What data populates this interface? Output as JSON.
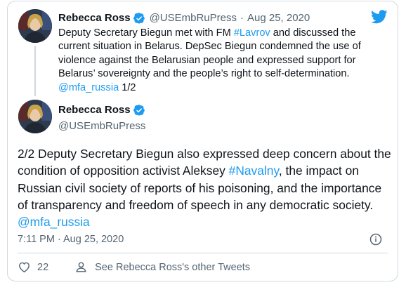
{
  "quoted": {
    "name": "Rebecca Ross",
    "handle": "@USEmbRuPress",
    "separator": "·",
    "date": "Aug 25, 2020",
    "text_1": "Deputy Secretary Biegun met with FM ",
    "hashtag": "#Lavrov",
    "text_2": " and discussed the current situation in Belarus. DepSec Biegun condemned the use of violence against the Belarusian people and expressed support for Belarus’ sovereignty and the people’s right to self-determination. ",
    "mention": "@mfa_russia",
    "suffix": " 1/2"
  },
  "main": {
    "name": "Rebecca Ross",
    "handle": "@USEmbRuPress",
    "text_1": "2/2  Deputy Secretary Biegun also expressed deep concern about the condition of opposition activist Aleksey ",
    "hashtag": "#Navalny",
    "text_2": ", the impact on Russian civil society of reports of his poisoning, and the importance of transparency and freedom of speech in any democratic society. ",
    "mention": "@mfa_russia",
    "timestamp": "7:11 PM · Aug 25, 2020"
  },
  "actions": {
    "like_count": "22",
    "other_tweets_label": "See Rebecca Ross's other Tweets"
  },
  "colors": {
    "link": "#1d9bf0",
    "muted": "#536471",
    "border": "#cfd9de",
    "twitter_blue": "#1d9bf0"
  },
  "icons": [
    "twitter-bird-icon",
    "verified-badge-icon",
    "info-icon",
    "heart-icon",
    "person-icon"
  ]
}
